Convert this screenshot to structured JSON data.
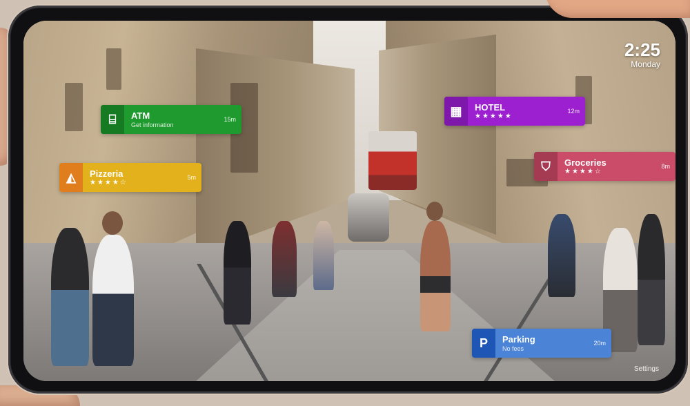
{
  "status": {
    "time": "2:25",
    "day": "Monday"
  },
  "ar_labels": {
    "atm": {
      "icon": "atm-icon",
      "name": "ATM",
      "subtitle": "Get information",
      "distance": "15m",
      "color": "#1f9a2e"
    },
    "pizzeria": {
      "icon": "pizza-icon",
      "name": "Pizzeria",
      "stars": "★★★★☆",
      "distance": "5m",
      "color": "#e2b11c"
    },
    "hotel": {
      "icon": "hotel-icon",
      "name": "HOTEL",
      "stars": "★★★★★",
      "distance": "12m",
      "color": "#9c1fd0"
    },
    "groceries": {
      "icon": "shopping-bag-icon",
      "name": "Groceries",
      "stars": "★★★★☆",
      "distance": "8m",
      "color": "#cb4c69"
    },
    "parking": {
      "icon": "parking-icon",
      "icon_letter": "P",
      "name": "Parking",
      "subtitle": "No fees",
      "distance": "20m",
      "color": "#4b83d6"
    }
  },
  "corner_text": "Settings"
}
